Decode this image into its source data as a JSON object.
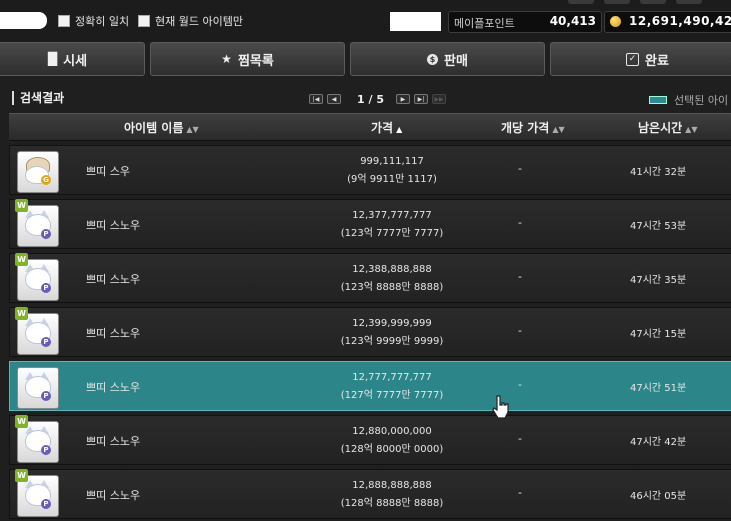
{
  "filters": {
    "exact_match_label": "정확히 일치",
    "current_world_label": "현재 월드 아이템만"
  },
  "balances": {
    "maple_points_label": "메이플포인트",
    "maple_points_value": "40,413",
    "meso_value": "12,691,490,42"
  },
  "tabs": [
    {
      "label": "시세",
      "icon": "chart-icon"
    },
    {
      "label": "찜목록",
      "icon": "star-icon"
    },
    {
      "label": "판매",
      "icon": "coin-icon"
    },
    {
      "label": "완료",
      "icon": "checkbox-icon"
    }
  ],
  "results": {
    "title": "검색결과",
    "page_text": "1 / 5",
    "legend_label": "선택된 아이"
  },
  "columns": {
    "name": "아이템 이름",
    "price": "가격",
    "unit_price": "개당 가격",
    "remaining": "남은시간"
  },
  "rows": [
    {
      "name": "쁘띠 스우",
      "price": "999,111,117",
      "price_detail": "(9억 9911만 1117)",
      "unit": "-",
      "time": "41시간 32분",
      "w_badge": "",
      "selected": false
    },
    {
      "name": "쁘띠 스노우",
      "price": "12,377,777,777",
      "price_detail": "(123억 7777만 7777)",
      "unit": "-",
      "time": "47시간 53분",
      "w_badge": "W",
      "selected": false
    },
    {
      "name": "쁘띠 스노우",
      "price": "12,388,888,888",
      "price_detail": "(123억 8888만 8888)",
      "unit": "-",
      "time": "47시간 35분",
      "w_badge": "W",
      "selected": false
    },
    {
      "name": "쁘띠 스노우",
      "price": "12,399,999,999",
      "price_detail": "(123억 9999만 9999)",
      "unit": "-",
      "time": "47시간 15분",
      "w_badge": "W",
      "selected": false
    },
    {
      "name": "쁘띠 스노우",
      "price": "12,777,777,777",
      "price_detail": "(127억 7777만 7777)",
      "unit": "-",
      "time": "47시간 51분",
      "w_badge": "",
      "selected": true
    },
    {
      "name": "쁘띠 스노우",
      "price": "12,880,000,000",
      "price_detail": "(128억 8000만 0000)",
      "unit": "-",
      "time": "47시간 42분",
      "w_badge": "W",
      "selected": false
    },
    {
      "name": "쁘띠 스노우",
      "price": "12,888,888,888",
      "price_detail": "(128억 8888만 8888)",
      "unit": "-",
      "time": "46시간 05분",
      "w_badge": "W",
      "selected": false
    }
  ]
}
